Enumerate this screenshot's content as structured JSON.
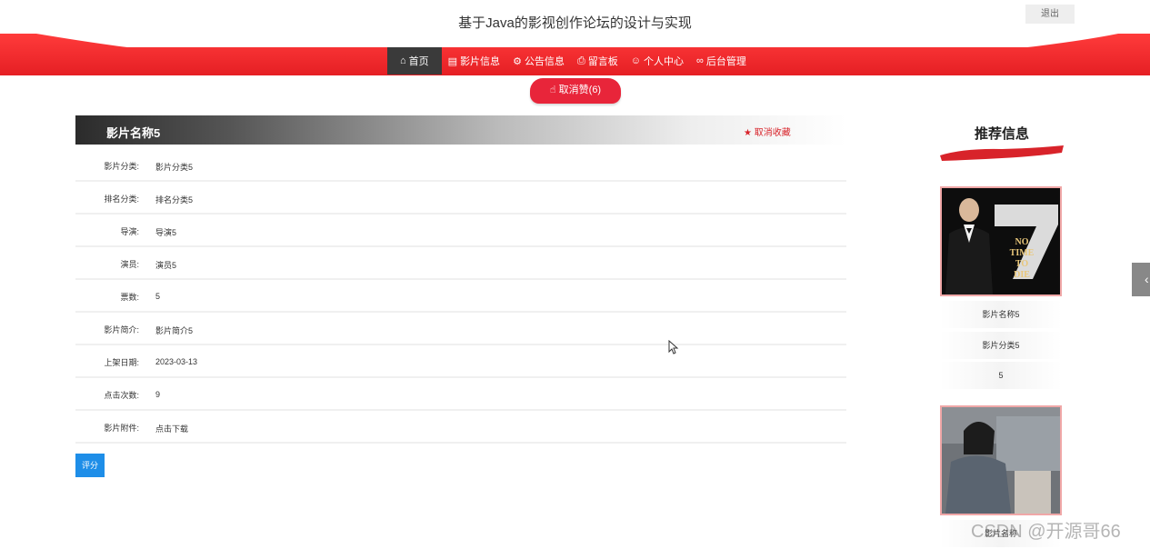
{
  "header": {
    "title": "基于Java的影视创作论坛的设计与实现",
    "logout_label": "退出"
  },
  "nav": {
    "items": [
      {
        "label": "首页",
        "icon": "home-icon"
      },
      {
        "label": "影片信息",
        "icon": "calendar-icon"
      },
      {
        "label": "公告信息",
        "icon": "gear-icon"
      },
      {
        "label": "留言板",
        "icon": "printer-icon"
      },
      {
        "label": "个人中心",
        "icon": "user-icon"
      },
      {
        "label": "后台管理",
        "icon": "link-icon"
      }
    ],
    "active_index": 0
  },
  "like": {
    "label": "取消赞(6)",
    "icon": "thumbs-up-icon"
  },
  "detail": {
    "title": "影片名称5",
    "favorite_label": "取消收藏",
    "rows": [
      {
        "label": "影片分类:",
        "value": "影片分类5"
      },
      {
        "label": "排名分类:",
        "value": "排名分类5"
      },
      {
        "label": "导演:",
        "value": "导演5"
      },
      {
        "label": "演员:",
        "value": "演员5"
      },
      {
        "label": "票数:",
        "value": "5"
      },
      {
        "label": "影片简介:",
        "value": "影片简介5"
      },
      {
        "label": "上架日期:",
        "value": "2023-03-13"
      },
      {
        "label": "点击次数:",
        "value": "9"
      },
      {
        "label": "影片附件:",
        "value": "点击下载"
      }
    ],
    "rate_label": "评分"
  },
  "recommend": {
    "title": "推荐信息",
    "items": [
      {
        "name": "影片名称5",
        "category": "影片分类5",
        "votes": "5"
      },
      {
        "name": "影片名称"
      }
    ]
  },
  "watermark": "CSDN @开源哥66",
  "colors": {
    "brand_red": "#e8253a",
    "nav_active": "#3a3a3a",
    "rate_button": "#1e8ee8",
    "favorite": "#d8232a"
  }
}
